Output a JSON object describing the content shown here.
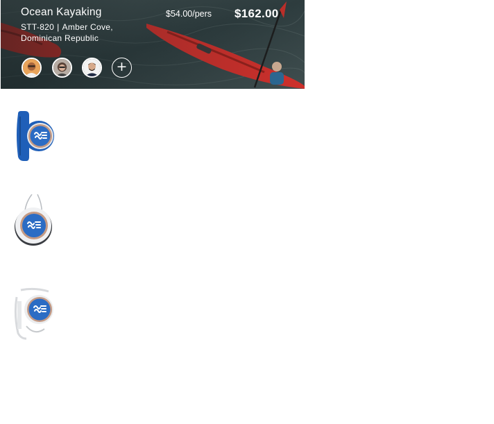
{
  "excursion": {
    "title": "Ocean Kayaking",
    "code": "STT-820",
    "separator": "|",
    "location": "Amber Cove, Dominican Republic",
    "price_per_person": "$54.00/pers",
    "total_price": "$162.00",
    "guests": [
      {
        "name": "guest-1"
      },
      {
        "name": "guest-2"
      },
      {
        "name": "guest-3"
      }
    ],
    "add_guest_label": "+"
  },
  "accessories": [
    {
      "name": "wristband-blue",
      "color": "#1f5fb8"
    },
    {
      "name": "pendant-necklace",
      "color": "#c9ccd0"
    },
    {
      "name": "clip-clear",
      "color": "#d8dadd"
    }
  ],
  "colors": {
    "medallion_blue": "#2b6cc4",
    "kayak_red": "#d8312c",
    "text": "#ffffff"
  }
}
